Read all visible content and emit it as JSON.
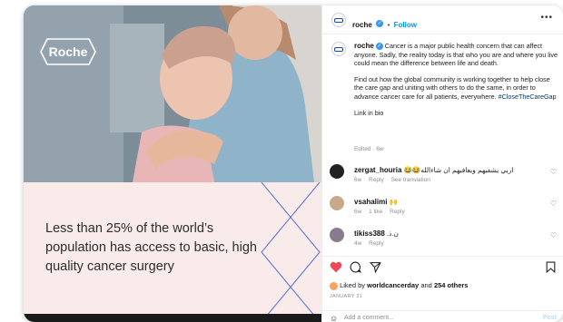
{
  "media": {
    "logo": "Roche",
    "caption": "Less than 25% of the world’s population has access to basic, high quality cancer surgery"
  },
  "header": {
    "username": "roche",
    "separator": "•",
    "follow_label": "Follow",
    "more_icon": "more-horizontal-icon"
  },
  "post": {
    "username": "roche",
    "text1": "Cancer is a major public health concern that can affect anyone. Sadly, the reality today is that who you are and where you live could mean the difference between life and death.",
    "text2": "Find out how the global community is working together to help close the care gap and uniting with others to do the same, in order to advance cancer care for all patients, everywhere.",
    "hashtag": "#CloseTheCareGap",
    "link": "Link in bio",
    "edited": "Edited · 6w"
  },
  "comments": [
    {
      "username": "zergat_houria",
      "text": "😂😂اربي يشفيهم ويعافيهم ان شاءالله",
      "time": "6w",
      "reply": "Reply",
      "extra": "See translation",
      "avatar_color": "#222222"
    },
    {
      "username": "vsahalimi",
      "text": "🙌",
      "time": "6w",
      "likes": "1 like",
      "reply": "Reply",
      "avatar_color": "#c9a98a"
    },
    {
      "username": "tikiss388",
      "text": ".ن.ذ",
      "time": "4w",
      "reply": "Reply",
      "avatar_color": "#8a7a8e"
    }
  ],
  "likes": {
    "prefix": "Liked by",
    "user": "worldcancerday",
    "mid": "and",
    "count": "254 others"
  },
  "date": "JANUARY 31",
  "add_comment": {
    "placeholder": "Add a comment...",
    "post_label": "Post"
  },
  "colors": {
    "accent": "#0095f6",
    "heart": "#ed4956",
    "caption_bg": "#f8ebe9",
    "line": "#5a6fd6"
  }
}
